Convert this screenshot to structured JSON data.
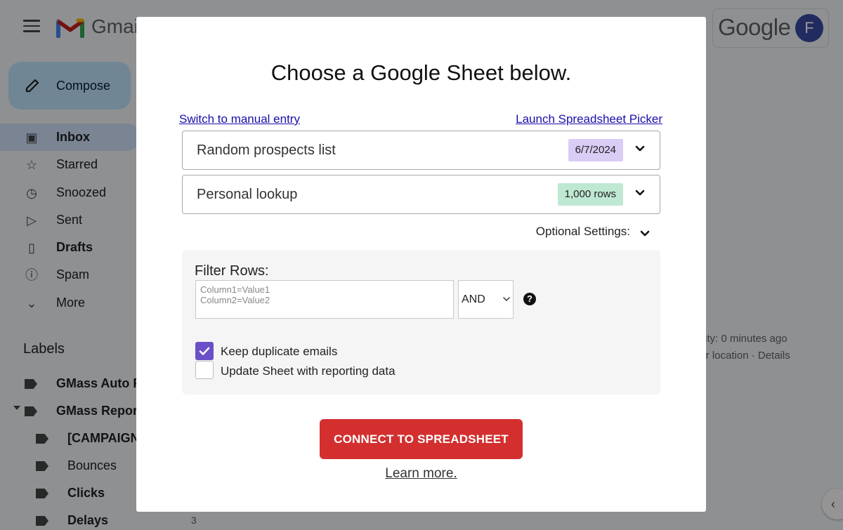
{
  "gmail": {
    "wordmark": "Gmai",
    "google_wordmark": "Google",
    "avatar_initial": "F",
    "compose_label": "Compose",
    "nav": [
      {
        "label": "Inbox",
        "icon": "inbox-icon",
        "bold": true,
        "active": true
      },
      {
        "label": "Starred",
        "icon": "star-icon",
        "bold": false
      },
      {
        "label": "Snoozed",
        "icon": "clock-icon",
        "bold": false
      },
      {
        "label": "Sent",
        "icon": "send-icon",
        "bold": false
      },
      {
        "label": "Drafts",
        "icon": "file-icon",
        "bold": true
      },
      {
        "label": "Spam",
        "icon": "alert-icon",
        "bold": false
      },
      {
        "label": "More",
        "icon": "chevron-down-icon",
        "bold": false
      }
    ],
    "labels_heading": "Labels",
    "labels": [
      {
        "label": "GMass Auto F",
        "bold": true
      },
      {
        "label": "GMass Report",
        "bold": true
      },
      {
        "label": "[CAMPAIGN",
        "bold": true
      },
      {
        "label": "Bounces",
        "bold": false
      },
      {
        "label": "Clicks",
        "bold": true
      },
      {
        "label": "Delays",
        "bold": true
      }
    ],
    "delays_count": "3",
    "activity_line1": "tivity: 0 minutes ago",
    "activity_line2": "ner location · Details"
  },
  "modal": {
    "title": "Choose a Google Sheet below.",
    "switch_link": "Switch to manual entry",
    "picker_link": "Launch Spreadsheet Picker",
    "sheet_select": {
      "value": "Random prospects list",
      "badge": "6/7/2024",
      "badge_color": "#d9ccf5"
    },
    "tab_select": {
      "value": "Personal lookup",
      "badge": "1,000 rows",
      "badge_color": "#bfe8d3"
    },
    "optional_settings_label": "Optional Settings:",
    "filter_label": "Filter Rows:",
    "filter_placeholder": "Column1=Value1\nColumn2=Value2",
    "operator_value": "AND",
    "help_symbol": "?",
    "keep_duplicates": {
      "label": "Keep duplicate emails",
      "checked": true
    },
    "update_sheet": {
      "label": "Update Sheet with reporting data",
      "checked": false
    },
    "connect_button": "CONNECT TO SPREADSHEET",
    "learn_more": "Learn more.",
    "accent_color": "#d32f2f",
    "checkbox_color": "#6a4fc7"
  }
}
